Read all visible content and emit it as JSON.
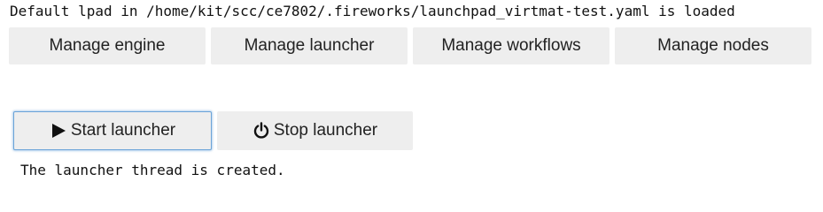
{
  "status": {
    "message": "Default lpad in /home/kit/scc/ce7802/.fireworks/launchpad_virtmat-test.yaml is loaded"
  },
  "tabs": [
    {
      "label": "Manage engine"
    },
    {
      "label": "Manage launcher"
    },
    {
      "label": "Manage workflows"
    },
    {
      "label": "Manage nodes"
    }
  ],
  "controls": {
    "start": {
      "label": "Start launcher",
      "icon": "play-icon"
    },
    "stop": {
      "label": "Stop launcher",
      "icon": "power-icon"
    }
  },
  "output": {
    "message": "The launcher thread is created."
  },
  "colors": {
    "button_bg": "#eeeeee",
    "focus_border": "#6aa3d8"
  }
}
